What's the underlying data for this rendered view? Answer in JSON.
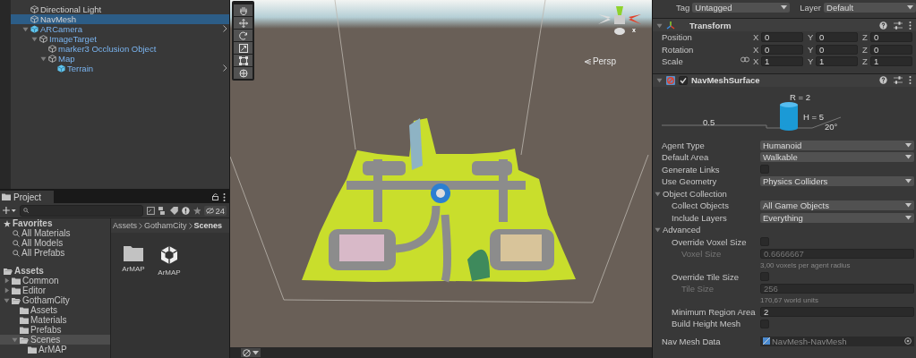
{
  "hierarchy": {
    "items": [
      {
        "name": "Directional Light",
        "kind": "object",
        "selected": false
      },
      {
        "name": "NavMesh",
        "kind": "object",
        "selected": true
      },
      {
        "name": "ARCamera",
        "kind": "prefab_root",
        "selected": false,
        "expanded": true,
        "children": [
          {
            "name": "ImageTarget",
            "kind": "prefab_part",
            "selected": false,
            "expanded": true,
            "children": [
              {
                "name": "marker3 Occlusion Object",
                "kind": "prefab_part",
                "selected": false
              },
              {
                "name": "Map",
                "kind": "prefab_part",
                "selected": false,
                "expanded": true,
                "children": [
                  {
                    "name": "Terrain",
                    "kind": "prefab_root",
                    "selected": false
                  }
                ]
              }
            ]
          }
        ]
      }
    ]
  },
  "project": {
    "tab": "Project",
    "hidden_count": "24",
    "favorites": {
      "label": "Favorites",
      "items": [
        "All Materials",
        "All Models",
        "All Prefabs"
      ]
    },
    "assets": {
      "label": "Assets",
      "children": [
        {
          "name": "Common",
          "expanded": false,
          "selected": false
        },
        {
          "name": "Editor",
          "expanded": false,
          "selected": false
        },
        {
          "name": "GothamCity",
          "expanded": true,
          "selected": false,
          "children": [
            {
              "name": "Assets",
              "selected": false
            },
            {
              "name": "Materials",
              "selected": false
            },
            {
              "name": "Prefabs",
              "selected": false
            },
            {
              "name": "Scenes",
              "expanded": true,
              "selected": true,
              "children": [
                {
                  "name": "ArMAP",
                  "selected": false
                }
              ]
            }
          ]
        }
      ]
    },
    "breadcrumb": [
      "Assets",
      "GothamCity",
      "Scenes"
    ],
    "files": [
      {
        "name": "ArMAP",
        "kind": "folder"
      },
      {
        "name": "ArMAP",
        "kind": "scene"
      }
    ]
  },
  "scene_view": {
    "projection": "Persp",
    "gizmo_axis": "x"
  },
  "inspector": {
    "tag": {
      "label": "Tag",
      "value": "Untagged"
    },
    "layer": {
      "label": "Layer",
      "value": "Default"
    },
    "transform": {
      "title": "Transform",
      "rows": [
        {
          "label": "Position",
          "linked": false,
          "fields": [
            {
              "axis": "X",
              "value": "0"
            },
            {
              "axis": "Y",
              "value": "0"
            },
            {
              "axis": "Z",
              "value": "0"
            }
          ]
        },
        {
          "label": "Rotation",
          "linked": false,
          "fields": [
            {
              "axis": "X",
              "value": "0"
            },
            {
              "axis": "Y",
              "value": "0"
            },
            {
              "axis": "Z",
              "value": "0"
            }
          ]
        },
        {
          "label": "Scale",
          "linked": true,
          "fields": [
            {
              "axis": "X",
              "value": "1"
            },
            {
              "axis": "Y",
              "value": "1"
            },
            {
              "axis": "Z",
              "value": "1"
            }
          ]
        }
      ]
    },
    "navmesh_surface": {
      "title": "NavMeshSurface",
      "enabled": true,
      "agent": {
        "radius": "R = 2",
        "height": "H = 5",
        "step": "0.5",
        "slope": "20°"
      },
      "properties": [
        {
          "kind": "dropdown",
          "label": "Agent Type",
          "value": "Humanoid"
        },
        {
          "kind": "dropdown",
          "label": "Default Area",
          "value": "Walkable"
        },
        {
          "kind": "checkbox",
          "label": "Generate Links",
          "checked": false
        },
        {
          "kind": "dropdown",
          "label": "Use Geometry",
          "value": "Physics Colliders"
        },
        {
          "kind": "foldout",
          "label": "Object Collection",
          "expanded": true,
          "children": [
            {
              "kind": "dropdown",
              "label": "Collect Objects",
              "value": "All Game Objects"
            },
            {
              "kind": "dropdown",
              "label": "Include Layers",
              "value": "Everything"
            }
          ]
        },
        {
          "kind": "foldout",
          "label": "Advanced",
          "expanded": true,
          "children": [
            {
              "kind": "checkbox",
              "label": "Override Voxel Size",
              "checked": false,
              "children": [
                {
                  "kind": "field",
                  "label": "Voxel Size",
                  "value": "0.6666667",
                  "disabled": true
                },
                {
                  "kind": "hint",
                  "label": "3,00 voxels per agent radius"
                }
              ]
            },
            {
              "kind": "checkbox",
              "label": "Override Tile Size",
              "checked": false,
              "children": [
                {
                  "kind": "field",
                  "label": "Tile Size",
                  "value": "256",
                  "disabled": true
                },
                {
                  "kind": "hint",
                  "label": "170,67 world units"
                }
              ]
            },
            {
              "kind": "field",
              "label": "Minimum Region Area",
              "value": "2",
              "disabled": false
            },
            {
              "kind": "checkbox",
              "label": "Build Height Mesh",
              "checked": false
            }
          ]
        },
        {
          "kind": "object",
          "label": "Nav Mesh Data",
          "value": "NavMesh-NavMesh"
        }
      ]
    }
  }
}
